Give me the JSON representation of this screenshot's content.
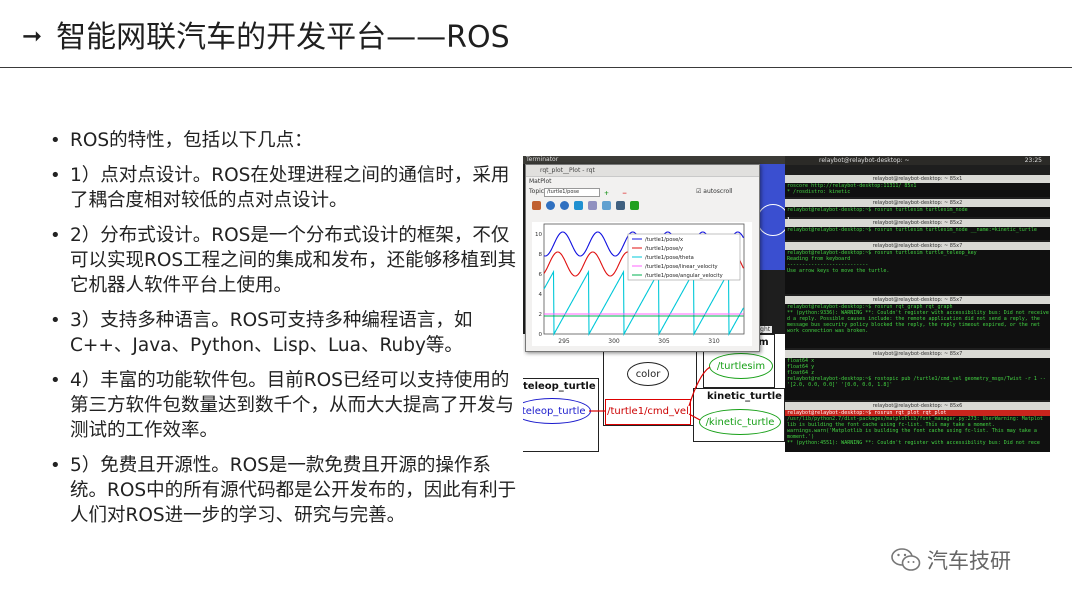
{
  "slide": {
    "title": "智能网联汽车的开发平台——ROS",
    "bullets": [
      "ROS的特性，包括以下几点：",
      "1）点对点设计。ROS在处理进程之间的通信时，采用了耦合度相对较低的点对点设计。",
      "2）分布式设计。ROS是一个分布式设计的框架，不仅可以实现ROS工程之间的集成和发布，还能够移植到其它机器人软件平台上使用。",
      "3）支持多种语言。ROS可支持多种编程语言，如C++、Java、Python、Lisp、Lua、Ruby等。",
      "4）丰富的功能软件包。目前ROS已经可以支持使用的第三方软件包数量达到数千个，从而大大提高了开发与测试的工作效率。",
      "5）免费且开源性。ROS是一款免费且开源的操作系统。ROS中的所有源代码都是公开发布的，因此有利于人们对ROS进一步的学习、研究与完善。"
    ]
  },
  "screenshot": {
    "terminator_label": "Terminator",
    "topbar_title": "relaybot@relaybot-desktop: ~",
    "clock": "23:25",
    "rqt": {
      "title": "rqt_plot__Plot - rqt",
      "matplot_label": "MatPlot",
      "topic_label": "Topic",
      "topic_value": "/turtle1/pose",
      "autoscroll_label": "autoscroll",
      "legend": [
        "/turtle1/pose/x",
        "/turtle1/pose/y",
        "/turtle1/pose/theta",
        "/turtle1/pose/linear_velocity",
        "/turtle1/pose/angular_velocity"
      ],
      "x_ticks": [
        "295",
        "300",
        "305",
        "310"
      ],
      "y_ticks": [
        "10",
        "8",
        "6",
        "4",
        "2",
        "0"
      ],
      "highlight_label": "hlight"
    },
    "graph": {
      "turtle1": "turtle1",
      "color": "color",
      "teleop_box": "teleop_turtle",
      "teleop_node": "/teleop_turtle",
      "cmd_vel": "/turtle1/cmd_vel",
      "turtlesim_box": "turtlesim",
      "turtlesim_node": "/turtlesim",
      "kinetic_box": "kinetic_turtle",
      "kinetic_node": "/kinetic_turtle"
    },
    "terminals": [
      {
        "title": "relaybot@relaybot-desktop: ~ 85x1",
        "lines": [
          "roscore http://relaybot-desktop:11311/ 85x1",
          "* /rosdistro: kinetic"
        ]
      },
      {
        "title": "relaybot@relaybot-desktop: ~ 85x2",
        "lines": [
          "relaybot@relaybot-desktop:~$ rosrun turtlesim turtlesim_node"
        ]
      },
      {
        "title": "relaybot@relaybot-desktop: ~ 85x2",
        "lines": [
          "relaybot@relaybot-desktop:~$ rosrun turtlesim turtlesim_node __name:=kinetic_turtle"
        ]
      },
      {
        "title": "relaybot@relaybot-desktop: ~ 85x7",
        "lines": [
          "relaybot@relaybot-desktop:~$ rosrun turtlesim turtle_teleop_key",
          "Reading from keyboard",
          "---------------------------",
          "Use arrow keys to move the turtle."
        ]
      },
      {
        "title": "relaybot@relaybot-desktop: ~ 85x7",
        "lines": [
          "relaybot@relaybot-desktop:~$ rosrun rqt_graph rqt_graph",
          "** (python:9336): WARNING **: Couldn't register with accessibility bus: Did not receive",
          "d a reply. Possible causes include: the remote application did not send a reply, the",
          "message bus security policy blocked the reply, the reply timeout expired, or the net",
          "work connection was broken."
        ]
      },
      {
        "title": "relaybot@relaybot-desktop: ~ 85x7",
        "lines": [
          "  float64 x",
          "  float64 y",
          "  float64 z",
          "relaybot@relaybot-desktop:~$ rostopic pub /turtle1/cmd_vel geometry_msgs/Twist -r 1 --",
          "'[2.0, 0.0, 0.0]' '[0.0, 0.0, 1.8]'"
        ]
      },
      {
        "title": "relaybot@relaybot-desktop: ~ 85x6",
        "lines": [
          "relaybot@relaybot-desktop:~$ rosrun rqt_plot rqt_plot",
          "/usr/lib/python2.7/dist-packages/matplotlib/font_manager.py:273: UserWarning: Matplot",
          "lib is building the font cache using fc-list. This may take a moment.",
          "  warnings.warn('Matplotlib is building the font cache using fc-list. This may take a",
          "moment.')",
          "** (python:4551): WARNING **: Couldn't register with accessibility bus: Did not rece"
        ]
      }
    ]
  },
  "brand": {
    "label": "汽车技研",
    "icon": "wechat-icon"
  },
  "colors": {
    "terminal_green": "#43d443",
    "series_x": "#1010e0",
    "series_y": "#e01010",
    "series_theta": "#00c8d8",
    "series_linear_velocity": "#ff66ff",
    "series_angular_velocity": "#00b050"
  },
  "chart_data": {
    "type": "line",
    "x_range": [
      293,
      313
    ],
    "y_range": [
      0,
      11
    ],
    "series": [
      {
        "name": "/turtle1/pose/x",
        "color": "#1010e0",
        "kind": "sine",
        "center": 9.0,
        "amp": 1.2,
        "period": 3.5
      },
      {
        "name": "/turtle1/pose/y",
        "color": "#e01010",
        "kind": "sine",
        "center": 7.0,
        "amp": 1.2,
        "period": 3.5,
        "phase": 0.9
      },
      {
        "name": "/turtle1/pose/theta",
        "color": "#00c8d8",
        "kind": "saw",
        "low": 0.0,
        "high": 6.3,
        "period": 3.5
      },
      {
        "name": "/turtle1/pose/linear_velocity",
        "color": "#ff66ff",
        "kind": "const",
        "value": 2.0
      },
      {
        "name": "/turtle1/pose/angular_velocity",
        "color": "#00b050",
        "kind": "const",
        "value": 1.8
      }
    ]
  }
}
